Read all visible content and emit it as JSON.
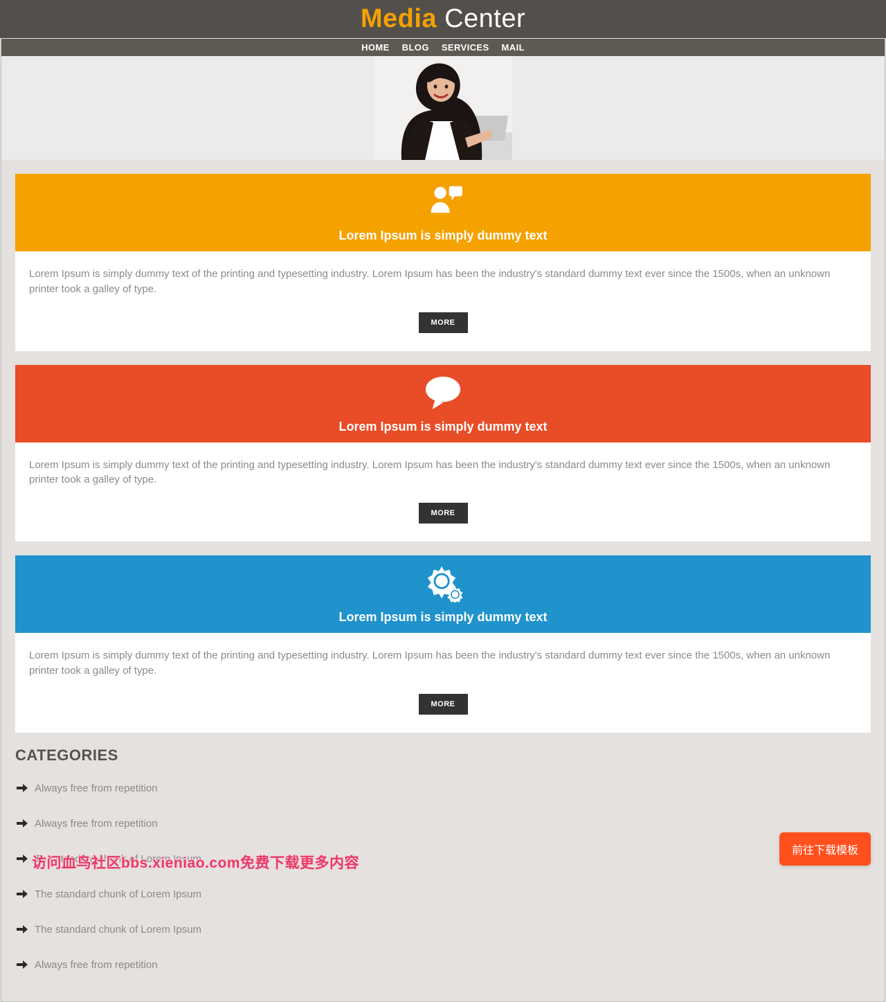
{
  "brand": {
    "first": "Media",
    "second": " Center"
  },
  "nav": [
    "HOME",
    "BLOG",
    "SERVICES",
    "MAIL"
  ],
  "cards": [
    {
      "color": "orange",
      "icon": "person-speech-icon",
      "title": "Lorem Ipsum is simply dummy text",
      "body": "Lorem Ipsum is simply dummy text of the printing and typesetting industry. Lorem Ipsum has been the industry's standard dummy text ever since the 1500s, when an unknown printer took a galley of type.",
      "cta": "MORE"
    },
    {
      "color": "red",
      "icon": "chat-bubble-icon",
      "title": "Lorem Ipsum is simply dummy text",
      "body": "Lorem Ipsum is simply dummy text of the printing and typesetting industry. Lorem Ipsum has been the industry's standard dummy text ever since the 1500s, when an unknown printer took a galley of type.",
      "cta": "MORE"
    },
    {
      "color": "blue",
      "icon": "gears-icon",
      "title": "Lorem Ipsum is simply dummy text",
      "body": "Lorem Ipsum is simply dummy text of the printing and typesetting industry. Lorem Ipsum has been the industry's standard dummy text ever since the 1500s, when an unknown printer took a galley of type.",
      "cta": "MORE"
    }
  ],
  "categories": {
    "heading": "CATEGORIES",
    "items": [
      "Always free from repetition",
      "Always free from repetition",
      "The standard chunk of Lorem Ipsum",
      "The standard chunk of Lorem Ipsum",
      "The standard chunk of Lorem Ipsum",
      "Always free from repetition"
    ]
  },
  "float_button": "前往下载模板",
  "watermark": "访问血鸟社区bbs.xieniao.com免费下载更多内容"
}
